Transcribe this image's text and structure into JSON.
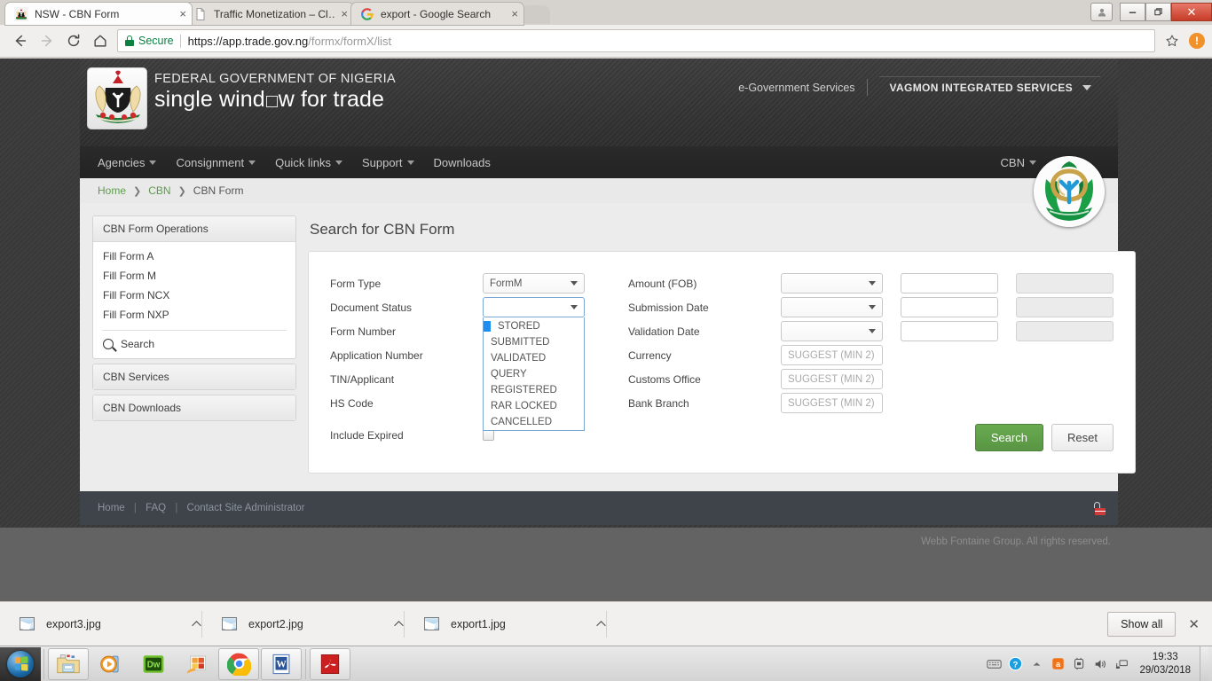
{
  "browser": {
    "tabs": [
      {
        "title": "NSW - CBN Form",
        "favicon": "nigeria-crest-favicon",
        "active": true,
        "close_label": "×"
      },
      {
        "title": "Traffic Monetization – Cl…",
        "favicon": "generic-page-favicon",
        "active": false,
        "close_label": "×"
      },
      {
        "title": "export - Google Search",
        "favicon": "google-favicon",
        "active": false,
        "close_label": "×"
      }
    ],
    "window_controls": {
      "profile": "☺",
      "minimize": "–",
      "maximize": "❐",
      "close": "✕"
    },
    "nav": {
      "back": "←",
      "forward": "→",
      "reload": "↻",
      "home": "⌂"
    },
    "omnibox": {
      "security_label": "Secure",
      "url_domain": "https://app.trade.gov.ng",
      "url_path": "/formx/formX/list",
      "bookmark_icon": "☆",
      "menu_alert": "!"
    }
  },
  "site": {
    "header": {
      "government_line": "FEDERAL GOVERNMENT OF NIGERIA",
      "brand_pre": "single wind",
      "brand_post": "w for trade",
      "egov_link": "e-Government Services",
      "organisation": "VAGMON INTEGRATED SERVICES"
    },
    "nav": {
      "items": [
        {
          "label": "Agencies",
          "has_caret": true
        },
        {
          "label": "Consignment",
          "has_caret": true
        },
        {
          "label": "Quick links",
          "has_caret": true
        },
        {
          "label": "Support",
          "has_caret": true
        },
        {
          "label": "Downloads",
          "has_caret": false
        }
      ],
      "right_item": {
        "label": "CBN",
        "has_caret": true
      }
    },
    "breadcrumb": [
      {
        "label": "Home",
        "current": false
      },
      {
        "label": "CBN",
        "current": false
      },
      {
        "label": "CBN Form",
        "current": true
      }
    ],
    "sidebar": {
      "panels": [
        {
          "title": "CBN Form Operations",
          "links": [
            "Fill Form A",
            "Fill Form M",
            "Fill Form NCX",
            "Fill Form NXP"
          ],
          "search_label": "Search"
        },
        {
          "title": "CBN Services",
          "links": [],
          "search_label": ""
        },
        {
          "title": "CBN Downloads",
          "links": [],
          "search_label": ""
        }
      ]
    },
    "main": {
      "title": "Search for CBN Form",
      "left_fields": [
        {
          "label": "Form Type",
          "control": "select",
          "value": "FormM"
        },
        {
          "label": "Document Status",
          "control": "select-open",
          "value": ""
        },
        {
          "label": "Form Number",
          "control": "hidden",
          "value": ""
        },
        {
          "label": "Application Number",
          "control": "hidden",
          "value": ""
        },
        {
          "label": "TIN/Applicant",
          "control": "hidden",
          "value": ""
        },
        {
          "label": "HS Code",
          "control": "hidden",
          "value": ""
        }
      ],
      "document_status_options": [
        "",
        "STORED",
        "SUBMITTED",
        "VALIDATED",
        "QUERY",
        "REGISTERED",
        "RAR LOCKED",
        "CANCELLED"
      ],
      "right_fields": [
        {
          "label": "Amount (FOB)",
          "control": "range",
          "select_value": "",
          "input1": "",
          "input2": "",
          "input2_disabled": true
        },
        {
          "label": "Submission Date",
          "control": "range",
          "select_value": "",
          "input1": "",
          "input2": "",
          "input2_disabled": true
        },
        {
          "label": "Validation Date",
          "control": "range",
          "select_value": "",
          "input1": "",
          "input2": "",
          "input2_disabled": true
        },
        {
          "label": "Currency",
          "control": "suggest",
          "placeholder": "SUGGEST (MIN 2)"
        },
        {
          "label": "Customs Office",
          "control": "suggest",
          "placeholder": "SUGGEST (MIN 2)"
        },
        {
          "label": "Bank Branch",
          "control": "suggest",
          "placeholder": "SUGGEST (MIN 2)"
        }
      ],
      "include_expired_label": "Include Expired",
      "include_expired_checked": false,
      "search_button": "Search",
      "reset_button": "Reset"
    },
    "footer": {
      "links": [
        "Home",
        "FAQ",
        "Contact Site Administrator"
      ],
      "separator": "|",
      "lock_icon": "unlocked-padlock-icon",
      "copyright": "Webb Fontaine Group. All rights reserved."
    },
    "colors": {
      "accent_green": "#5f9b4e",
      "button_green": "#599544",
      "dropdown_highlight": "#1f8ef1",
      "footer_dark": "#3f444b"
    }
  },
  "download_shelf": {
    "items": [
      {
        "name": "export3.jpg",
        "icon": "image-file-icon",
        "caret": "ⱏ"
      },
      {
        "name": "export2.jpg",
        "icon": "image-file-icon",
        "caret": "ⱏ"
      },
      {
        "name": "export1.jpg",
        "icon": "image-file-icon",
        "caret": "ⱏ"
      }
    ],
    "show_all": "Show all",
    "close": "✕"
  },
  "taskbar": {
    "start_label": "windows-start-orb",
    "pinned": [
      {
        "name": "windows-explorer-icon",
        "active": true
      },
      {
        "name": "windows-media-player-icon",
        "active": false
      },
      {
        "name": "dreamweaver-icon",
        "label": "Dw",
        "active": false
      },
      {
        "name": "photo-viewer-icon",
        "active": false
      },
      {
        "name": "google-chrome-icon",
        "active": true
      },
      {
        "name": "microsoft-word-icon",
        "label": "W",
        "active": true
      },
      {
        "name": "adobe-acrobat-icon",
        "active": true
      }
    ],
    "tray": [
      {
        "name": "on-screen-keyboard-icon",
        "glyph": "⌨"
      },
      {
        "name": "help-icon",
        "glyph": "?"
      },
      {
        "name": "show-hidden-icons-chevron",
        "glyph": "▲"
      },
      {
        "name": "avast-antivirus-icon",
        "glyph": "a"
      },
      {
        "name": "safely-remove-hardware-icon",
        "glyph": "⌘"
      },
      {
        "name": "volume-icon",
        "glyph": "🔊"
      },
      {
        "name": "network-icon",
        "glyph": "⌨"
      }
    ],
    "clock_time": "19:33",
    "clock_date": "29/03/2018"
  }
}
